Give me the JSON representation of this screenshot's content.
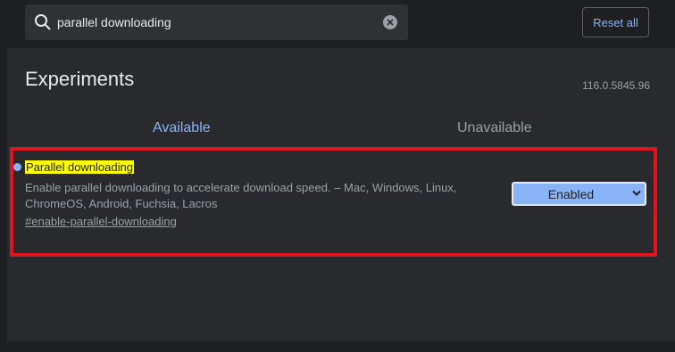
{
  "search": {
    "value": "parallel downloading"
  },
  "toolbar": {
    "reset_label": "Reset all"
  },
  "page": {
    "title": "Experiments",
    "version": "116.0.5845.96"
  },
  "tabs": [
    {
      "label": "Available"
    },
    {
      "label": "Unavailable"
    }
  ],
  "experiment": {
    "name": "Parallel downloading",
    "description": "Enable parallel downloading to accelerate download speed. – Mac, Windows, Linux, ChromeOS, Android, Fuchsia, Lacros",
    "link": "#enable-parallel-downloading",
    "selected_option": "Enabled"
  },
  "colors": {
    "accent": "#8ab4f8",
    "highlight": "#ffff00",
    "annotation_border": "#e0141e"
  },
  "icons": [
    "search-icon",
    "clear-icon",
    "chevron-down-icon"
  ]
}
